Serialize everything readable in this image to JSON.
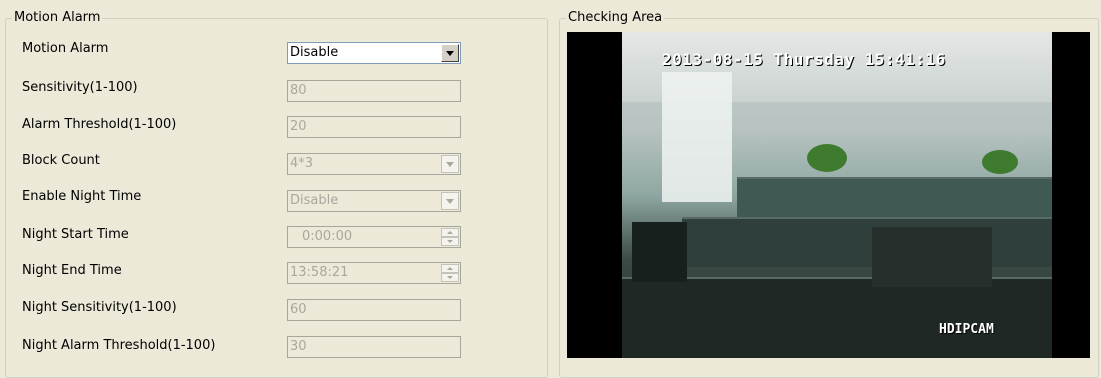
{
  "motion_panel": {
    "title": "Motion Alarm",
    "rows": [
      {
        "label": "Motion Alarm",
        "value": "Disable",
        "kind": "dropdown",
        "enabled": true
      },
      {
        "label": "Sensitivity(1-100)",
        "value": "80",
        "kind": "text",
        "enabled": false
      },
      {
        "label": "Alarm Threshold(1-100)",
        "value": "20",
        "kind": "text",
        "enabled": false
      },
      {
        "label": "Block Count",
        "value": "4*3",
        "kind": "dropdown",
        "enabled": false
      },
      {
        "label": "Enable Night Time",
        "value": "Disable",
        "kind": "dropdown",
        "enabled": false
      },
      {
        "label": "Night Start Time",
        "value": "0:00:00",
        "kind": "time",
        "enabled": false
      },
      {
        "label": "Night End Time",
        "value": "13:58:21",
        "kind": "time",
        "enabled": false
      },
      {
        "label": "Night Sensitivity(1-100)",
        "value": "60",
        "kind": "text",
        "enabled": false
      },
      {
        "label": "Night Alarm Threshold(1-100)",
        "value": "30",
        "kind": "text",
        "enabled": false
      }
    ]
  },
  "checking_panel": {
    "title": "Checking Area",
    "osd_timestamp": "2013-08-15 Thursday 15:41:16",
    "osd_name": "HDIPCAM"
  }
}
